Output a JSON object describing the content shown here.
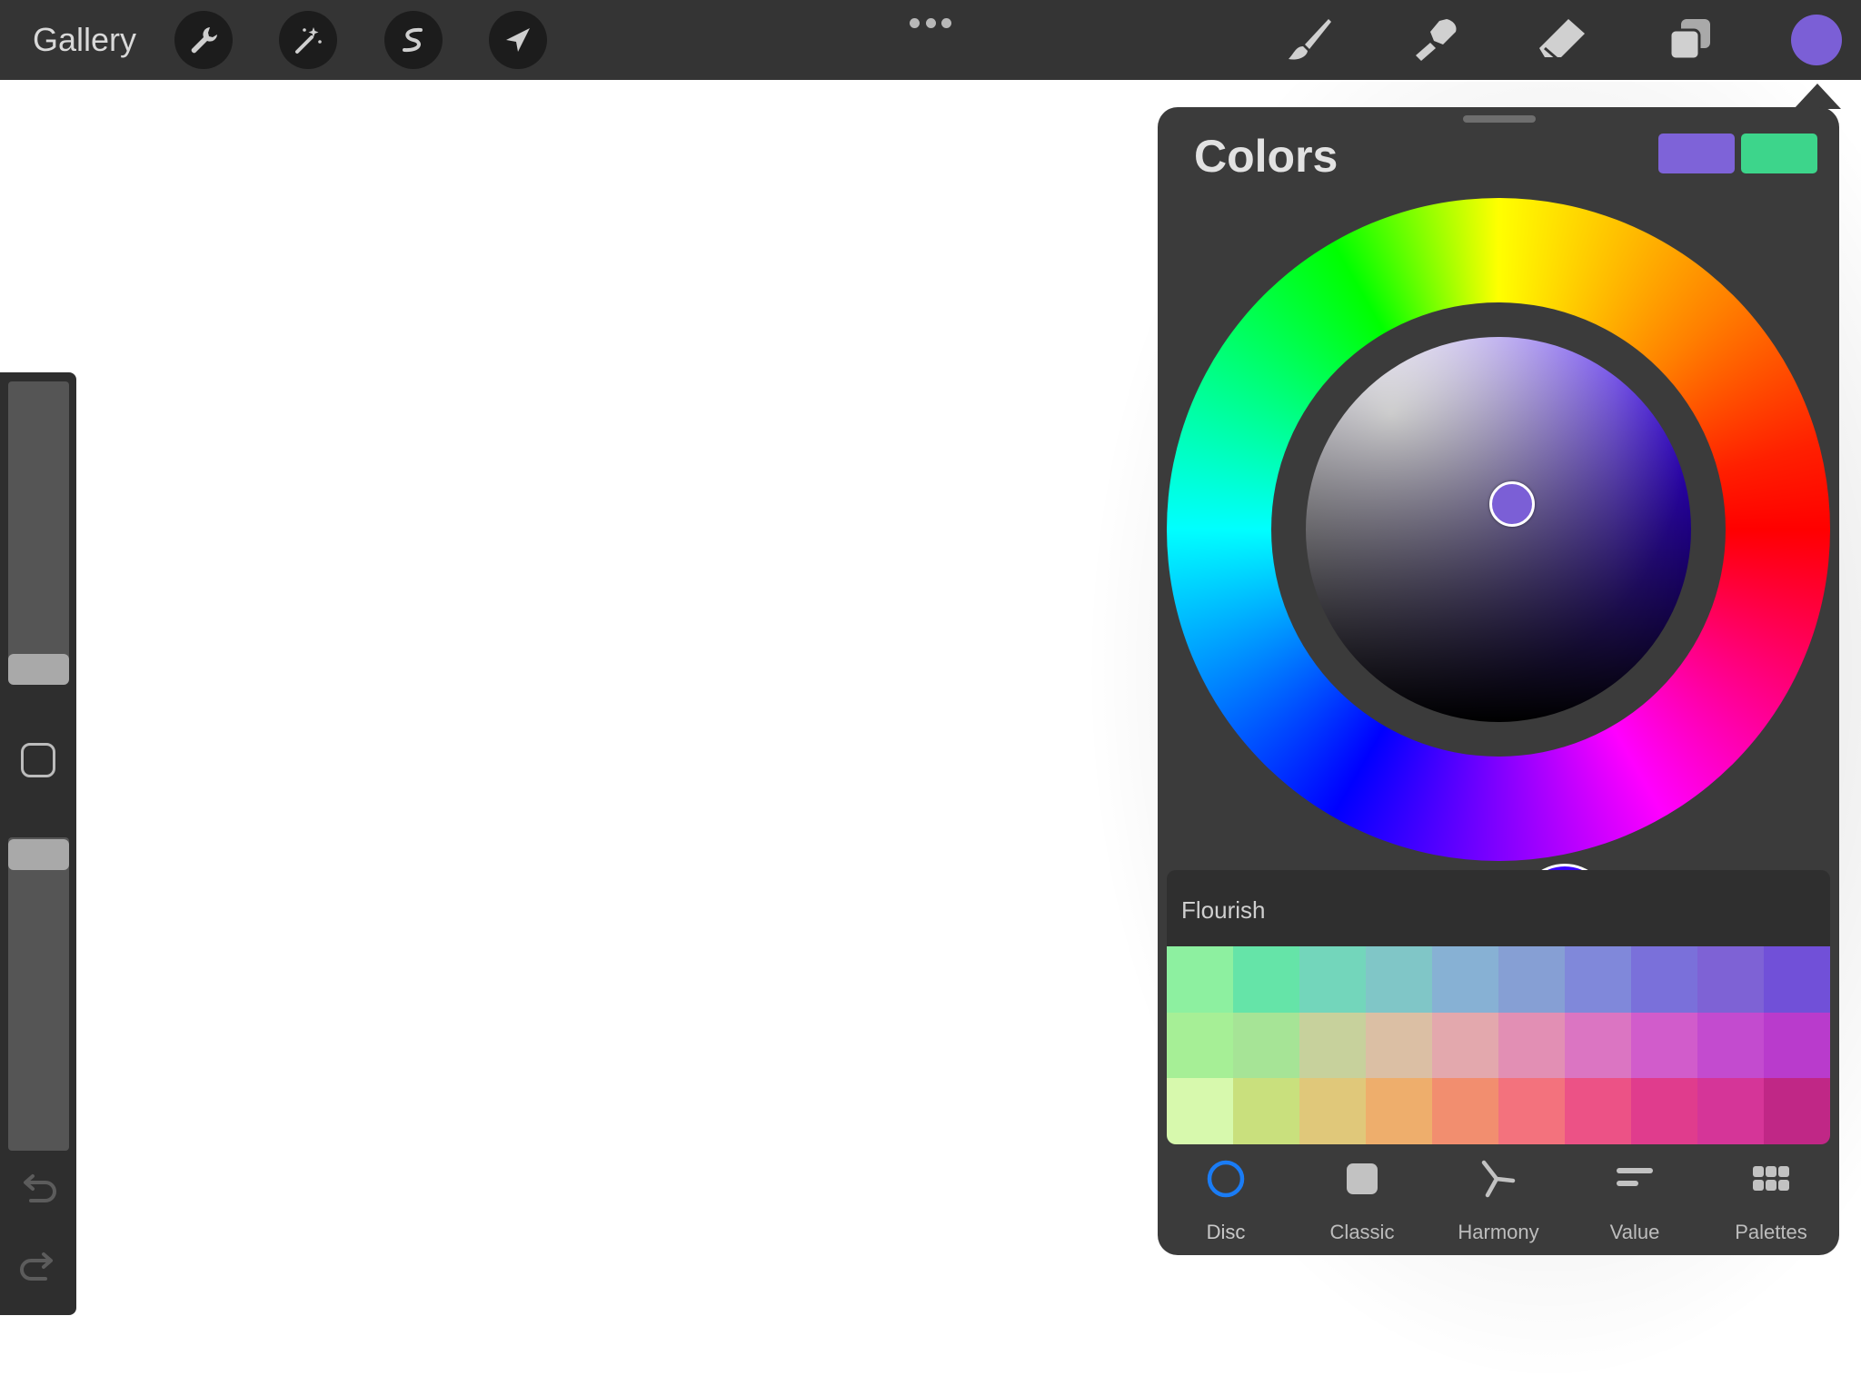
{
  "topbar": {
    "gallery_label": "Gallery",
    "left_tools": [
      "wrench-icon",
      "magic-wand-icon",
      "selection-icon",
      "move-arrow-icon"
    ],
    "right_tools": [
      "brush-icon",
      "smudge-icon",
      "eraser-icon",
      "layers-icon"
    ],
    "current_color": "#7b5fd6"
  },
  "sidebar": {
    "size_slider_level": 0.95,
    "opacity_slider_level": 0.0
  },
  "colors_panel": {
    "title": "Colors",
    "current_swatch": "#7e63d8",
    "previous_swatch": "#3dd58b",
    "selected_color": "#7b5fd6",
    "hue_color": "#3a00ff",
    "palette": {
      "name": "Flourish",
      "rows": [
        [
          "#8df0a0",
          "#65e4a8",
          "#73d6bb",
          "#80c6c7",
          "#87b1d4",
          "#869fd4",
          "#8088da",
          "#7a70da",
          "#7e62d5",
          "#7150d8"
        ],
        [
          "#a6ef96",
          "#a6e496",
          "#c7d19c",
          "#dbbfa4",
          "#e3a8ad",
          "#e28fb4",
          "#db75c2",
          "#d15ccb",
          "#c34bcf",
          "#b93bcc"
        ],
        [
          "#d7f9ad",
          "#c9e07d",
          "#e0c87a",
          "#eeae6c",
          "#f28e6f",
          "#f3727d",
          "#ec5286",
          "#e03c8d",
          "#d53598",
          "#c02786"
        ]
      ]
    },
    "tabs": [
      {
        "label": "Disc",
        "icon": "disc-icon",
        "active": true
      },
      {
        "label": "Classic",
        "icon": "classic-square-icon",
        "active": false
      },
      {
        "label": "Harmony",
        "icon": "harmony-icon",
        "active": false
      },
      {
        "label": "Value",
        "icon": "value-sliders-icon",
        "active": false
      },
      {
        "label": "Palettes",
        "icon": "palettes-grid-icon",
        "active": false
      }
    ]
  }
}
